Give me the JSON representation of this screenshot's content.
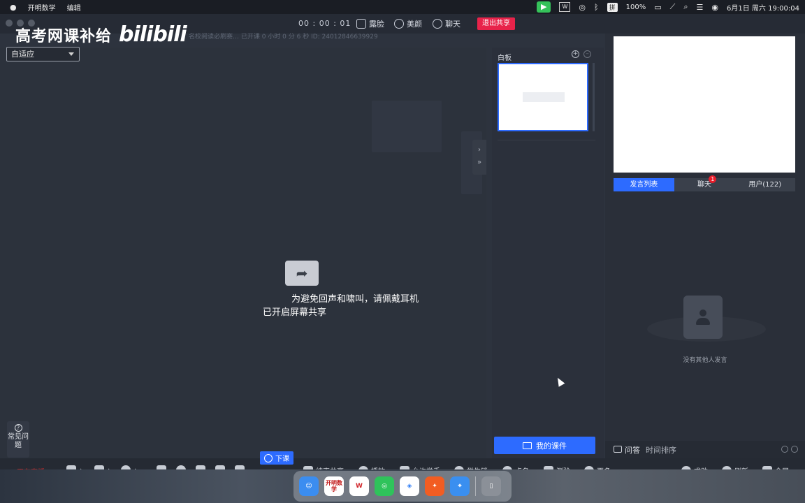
{
  "menubar": {
    "app_name": "开明数学",
    "edit_menu": "编辑",
    "battery": "100%",
    "datetime": "6月1日 周六  19:00:04",
    "input_method": "拼",
    "video_icon": "video-camera-icon"
  },
  "window": {
    "course_info": "名校阅读必刷赛…     已开课 0 小时 0 分 6 秒   ID: 24012846639929",
    "timer": "00 : 00 : 01",
    "actions": {
      "show_face": "露脸",
      "beauty": "美颜",
      "chat": "聊天",
      "exit_share": "退出共享"
    }
  },
  "watermark": {
    "text": "高考网课补给",
    "brand": "bilibili"
  },
  "fit_select": {
    "value": "自适应"
  },
  "share_area": {
    "echo_tip": "为避免回声和啸叫，请佩戴耳机",
    "status": "已开启屏幕共享",
    "faq": "常见问题"
  },
  "whiteboard": {
    "label": "白板",
    "my_course": "我的课件"
  },
  "right_panel": {
    "tabs": [
      {
        "label": "发言列表",
        "active": true
      },
      {
        "label": "聊天",
        "badge": "1"
      },
      {
        "label": "用户(122)"
      }
    ],
    "empty_text": "没有其他人发言",
    "qa_label": "问答",
    "qa_sort": "时间排序"
  },
  "toolbar": {
    "left_red": "正在直播",
    "end_class": "下课",
    "items": {
      "end_share": "结束共享",
      "play": "播放",
      "allow_raise": "允许举手",
      "student_lock": "学生锁",
      "roll_call": "点名",
      "quiz": "测验",
      "more": "更多",
      "help": "求助",
      "refresh": "刷新",
      "fullscreen": "全屏"
    }
  },
  "dock": {
    "apps": [
      "finder",
      "开明数学",
      "WPS",
      "wechat",
      "baidu-netdisk",
      "live-app",
      "safari",
      "trash"
    ],
    "kaiming_label": "开明数学"
  },
  "colors": {
    "accent": "#2d6bff",
    "exit_red": "#e8234a",
    "badge_red": "#e81d2b"
  }
}
